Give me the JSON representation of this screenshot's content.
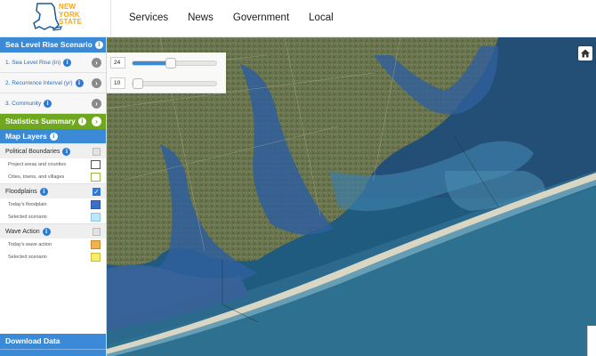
{
  "header": {
    "logo_text_lines": [
      "NEW",
      "YORK",
      "STATE"
    ],
    "nav": [
      "Services",
      "News",
      "Government",
      "Local"
    ]
  },
  "sidebar": {
    "scenario_title": "Sea Level Rise Scenario",
    "steps": [
      {
        "label": "1. Sea Level Rise (in)"
      },
      {
        "label": "2. Recurrence Interval (yr)"
      },
      {
        "label": "3. Community"
      }
    ],
    "stats_title": "Statistics Summary",
    "layers_title": "Map Layers",
    "groups": [
      {
        "title": "Political Boundaries",
        "checked": false,
        "legend": [
          {
            "label": "Project areas and counties",
            "color": "#ffffff",
            "border": "#555555"
          },
          {
            "label": "Cities, towns, and villages",
            "color": "#ffffff",
            "border": "#9ab84a"
          }
        ]
      },
      {
        "title": "Floodplains",
        "checked": true,
        "legend": [
          {
            "label": "Today's floodplain",
            "color": "#3d6fc7",
            "border": "#2d57a8"
          },
          {
            "label": "Selected scenario",
            "color": "#bfe6f7",
            "border": "#8cc8e6"
          }
        ]
      },
      {
        "title": "Wave Action",
        "checked": false,
        "legend": [
          {
            "label": "Today's wave action",
            "color": "#f3b04f",
            "border": "#c88a2e"
          },
          {
            "label": "Selected scenario",
            "color": "#f6ec6a",
            "border": "#c9bd3c"
          }
        ]
      }
    ],
    "download_title": "Download Data"
  },
  "sliders": {
    "sea_level": {
      "value": "24",
      "fraction": 0.45
    },
    "recurrence": {
      "value": "10",
      "fraction": 0.0
    }
  },
  "colors": {
    "accent_blue": "#3a8ad7",
    "accent_green": "#6fa81f",
    "logo_orange": "#f7a71b"
  },
  "icons": [
    "info-icon",
    "chevron-right-icon",
    "home-icon",
    "checkbox-icon"
  ]
}
